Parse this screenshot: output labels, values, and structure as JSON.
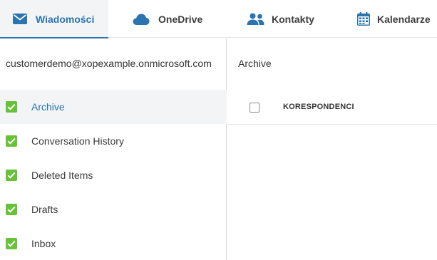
{
  "tabs": [
    {
      "label": "Wiadomości",
      "icon": "envelope-icon",
      "active": true
    },
    {
      "label": "OneDrive",
      "icon": "cloud-icon",
      "active": false
    },
    {
      "label": "Kontakty",
      "icon": "people-icon",
      "active": false
    },
    {
      "label": "Kalendarze",
      "icon": "calendar-icon",
      "active": false
    }
  ],
  "sidebar": {
    "account": "customerdemo@xopexample.onmicrosoft.com",
    "folders": [
      {
        "label": "Archive",
        "checked": true,
        "selected": true
      },
      {
        "label": "Conversation History",
        "checked": true,
        "selected": false
      },
      {
        "label": "Deleted Items",
        "checked": true,
        "selected": false
      },
      {
        "label": "Drafts",
        "checked": true,
        "selected": false
      },
      {
        "label": "Inbox",
        "checked": true,
        "selected": false
      }
    ]
  },
  "content": {
    "title": "Archive",
    "column_header": "KORESPONDENCI"
  },
  "colors": {
    "accent": "#2a74b0",
    "check_green": "#67c23a",
    "selected_bg": "#f2f4f6"
  }
}
